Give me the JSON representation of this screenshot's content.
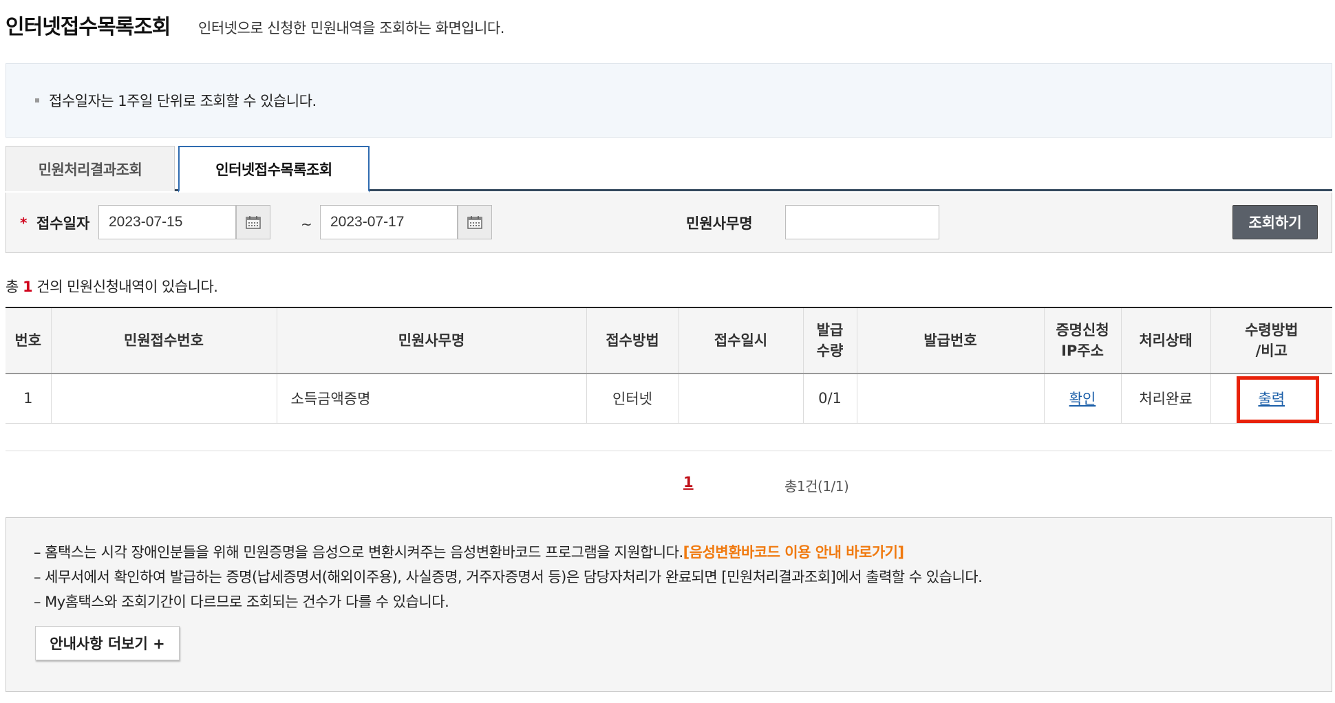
{
  "header": {
    "title": "인터넷접수목록조회",
    "description": "인터넷으로 신청한 민원내역을 조회하는 화면입니다."
  },
  "info": {
    "text": "접수일자는 1주일 단위로 조회할 수 있습니다."
  },
  "tabs": [
    {
      "label": "민원처리결과조회",
      "active": false
    },
    {
      "label": "인터넷접수목록조회",
      "active": true
    }
  ],
  "search": {
    "date_label": "접수일자",
    "required_mark": "*",
    "start_date": "2023-07-15",
    "separator": "~",
    "end_date": "2023-07-17",
    "doc_label": "민원사무명",
    "doc_value": "",
    "button_label": "조회하기"
  },
  "summary": {
    "prefix": "총 ",
    "count": "1",
    "suffix": " 건의 민원신청내역이 있습니다."
  },
  "table": {
    "headers": [
      [
        "번호"
      ],
      [
        "민원접수번호"
      ],
      [
        "민원사무명"
      ],
      [
        "접수방법"
      ],
      [
        "접수일시"
      ],
      [
        "발급",
        "수량"
      ],
      [
        "발급번호"
      ],
      [
        "증명신청",
        "IP주소"
      ],
      [
        "처리상태"
      ],
      [
        "수령방법",
        "/비고"
      ]
    ],
    "rows": [
      {
        "no": "1",
        "receipt_no": "",
        "doc_name": "소득금액증명",
        "method": "인터넷",
        "datetime": "",
        "qty": "0/1",
        "issue_no": "",
        "ip": "확인",
        "status": "처리완료",
        "receive": "출력"
      }
    ]
  },
  "pagination": {
    "current": "1",
    "total": "총1건(1/1)"
  },
  "notice": {
    "line1": "– 홈택스는 시각 장애인분들을 위해 민원증명을 음성으로 변환시켜주는 음성변환바코드 프로그램을 지원합니다.",
    "line1_link": "[음성변환바코드 이용 안내 바로가기]",
    "line2": "– 세무서에서 확인하여 발급하는 증명(납세증명서(해외이주용), 사실증명, 거주자증명서 등)은 담당자처리가 완료되면 [민원처리결과조회]에서 출력할 수 있습니다.",
    "line3": "– My홈택스와 조회기간이 다르므로 조회되는 건수가 다를 수 있습니다.",
    "more_button": "안내사항 더보기 +"
  },
  "colors": {
    "accent_red": "#d0021b",
    "link_blue": "#1a5ea8",
    "tab_border": "#2f6bb0",
    "highlight": "#e8220a",
    "orange": "#f07a10"
  }
}
